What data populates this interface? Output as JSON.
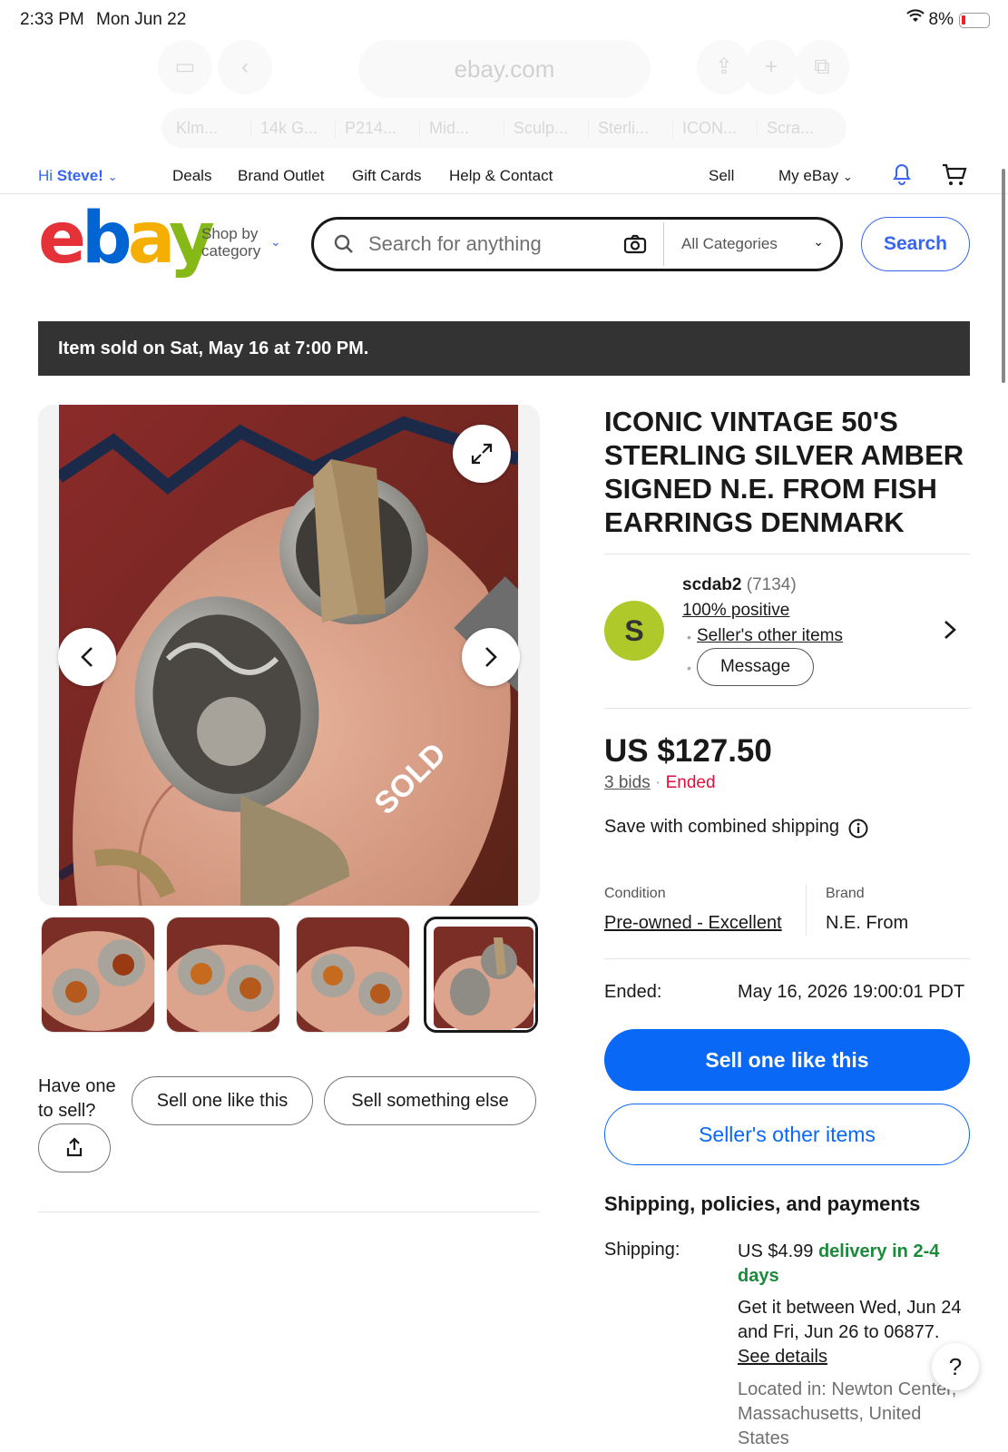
{
  "status_bar": {
    "time": "2:33 PM",
    "date": "Mon Jun 22",
    "battery": "8%"
  },
  "browser": {
    "url": "ebay.com",
    "tabs": [
      "Klm...",
      "14k G...",
      "P214...",
      "Mid...",
      "Sculp...",
      "Sterli...",
      "ICON...",
      "Scra..."
    ]
  },
  "top_nav": {
    "greeting": "Hi",
    "user": "Steve!",
    "links": [
      "Deals",
      "Brand Outlet",
      "Gift Cards",
      "Help & Contact"
    ],
    "sell": "Sell",
    "my_ebay": "My eBay"
  },
  "header": {
    "logo": "ebay",
    "shop_by_line1": "Shop by",
    "shop_by_line2": "category",
    "search_placeholder": "Search for anything",
    "category": "All Categories",
    "search_button": "Search"
  },
  "banner": {
    "text": "Item sold on Sat, May 16 at 7:00 PM."
  },
  "gallery": {
    "sold_label": "SOLD",
    "thumb_count": 4,
    "selected_thumb": 4
  },
  "sell_prompt": {
    "label": "Have one to sell?",
    "sell_one": "Sell one like this",
    "sell_else": "Sell something else"
  },
  "item": {
    "title": "ICONIC VINTAGE 50'S STERLING SILVER AMBER SIGNED N.E. FROM FISH EARRINGS DENMARK",
    "seller": {
      "initial": "S",
      "name": "scdab2",
      "feedback": "(7134)",
      "positive": "100% positive",
      "other_items": "Seller's other items",
      "message": "Message"
    },
    "price": "US $127.50",
    "bids": "3 bids",
    "status": "Ended",
    "combined_shipping": "Save with combined shipping",
    "condition_label": "Condition",
    "condition_value": "Pre-owned - Excellent",
    "brand_label": "Brand",
    "brand_value": "N.E. From",
    "ended_label": "Ended:",
    "ended_value": "May 16, 2026 19:00:01 PDT",
    "btn_sell_like": "Sell one like this",
    "btn_other_items": "Seller's other items"
  },
  "shipping": {
    "heading": "Shipping, policies, and payments",
    "label": "Shipping:",
    "cost": "US $4.99",
    "delivery": "delivery in 2-4 days",
    "window": "Get it between Wed, Jun 24 and Fri, Jun 26 to 06877.",
    "see_details": "See details",
    "located": "Located in: Newton Center, Massachusetts, United States"
  },
  "help": {
    "label": "?"
  },
  "colors": {
    "accent": "#3665f3",
    "primary_button": "#0968f6",
    "ended_red": "#e0103a",
    "delivery_green": "#1b8a3a",
    "avatar": "#b0c92a"
  }
}
